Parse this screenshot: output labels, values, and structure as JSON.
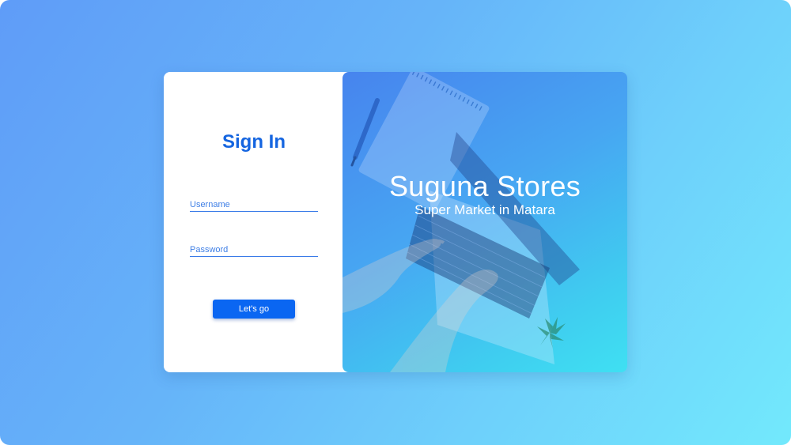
{
  "signin": {
    "title": "Sign In",
    "username_placeholder": "Username",
    "password_placeholder": "Password",
    "submit_label": "Let's go"
  },
  "hero": {
    "brand": "Suguna Stores",
    "tagline": "Super Market in Matara",
    "photo": "laptop-typing-hands-photo"
  },
  "colors": {
    "accent": "#1565e0",
    "button": "#0a66f2",
    "background_start": "#5f9cf8",
    "background_end": "#72e9fc"
  }
}
